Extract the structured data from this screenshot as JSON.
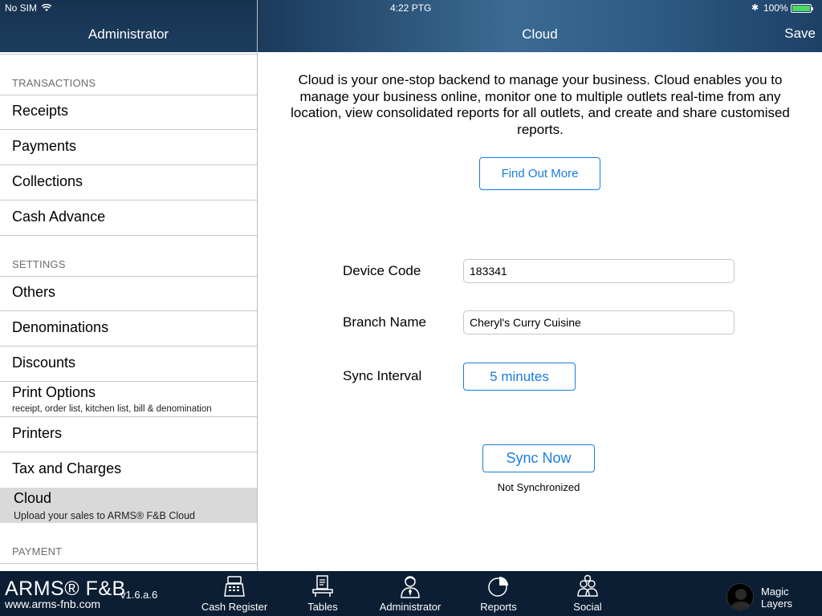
{
  "status_bar": {
    "carrier": "No SIM",
    "time": "4:22 PTG",
    "battery": "100%",
    "battery_level": 1.0
  },
  "sidebar_header": {
    "title": "Administrator"
  },
  "main_header": {
    "title": "Cloud",
    "save_label": "Save"
  },
  "sidebar": {
    "sections": [
      {
        "title": "TRANSACTIONS",
        "items": [
          "Receipts",
          "Payments",
          "Collections",
          "Cash Advance"
        ]
      },
      {
        "title": "SETTINGS",
        "items": [
          "Others",
          "Denominations",
          "Discounts"
        ]
      },
      {
        "title": "PAYMENT"
      }
    ],
    "print_options": {
      "label": "Print Options",
      "subtitle": "receipt, order list, kitchen list, bill & denomination"
    },
    "printers": "Printers",
    "tax_and_charges": "Tax and Charges",
    "cloud": {
      "label": "Cloud",
      "subtitle": "Upload your sales to ARMS® F&B Cloud"
    }
  },
  "main": {
    "description": "Cloud is your one-stop backend to manage your business. Cloud enables you to manage your business online, monitor one to multiple outlets real-time from any location, view consolidated reports for all outlets, and create and share customised reports.",
    "find_out_more": "Find Out More",
    "device_code_label": "Device Code",
    "device_code_value": "183341",
    "branch_name_label": "Branch Name",
    "branch_name_value": "Cheryl's Curry Cuisine",
    "sync_interval_label": "Sync Interval",
    "sync_interval_value": "5 minutes",
    "sync_now": "Sync Now",
    "sync_status": "Not Synchronized"
  },
  "tabbar": {
    "brand": "ARMS® F&B",
    "url": "www.arms-fnb.com",
    "version": "v1.6.a.6",
    "tabs": [
      {
        "label": "Cash Register",
        "icon": "cash-register-icon"
      },
      {
        "label": "Tables",
        "icon": "tables-icon"
      },
      {
        "label": "Administrator",
        "icon": "administrator-icon"
      },
      {
        "label": "Reports",
        "icon": "reports-icon"
      },
      {
        "label": "Social",
        "icon": "social-icon"
      }
    ],
    "user": "Magic Layers"
  },
  "colors": {
    "accent": "#1a7de0",
    "nav_bar": "#1d3d5e",
    "tab_bar": "#0b1e33",
    "selected_row": "#d9d9d9"
  }
}
